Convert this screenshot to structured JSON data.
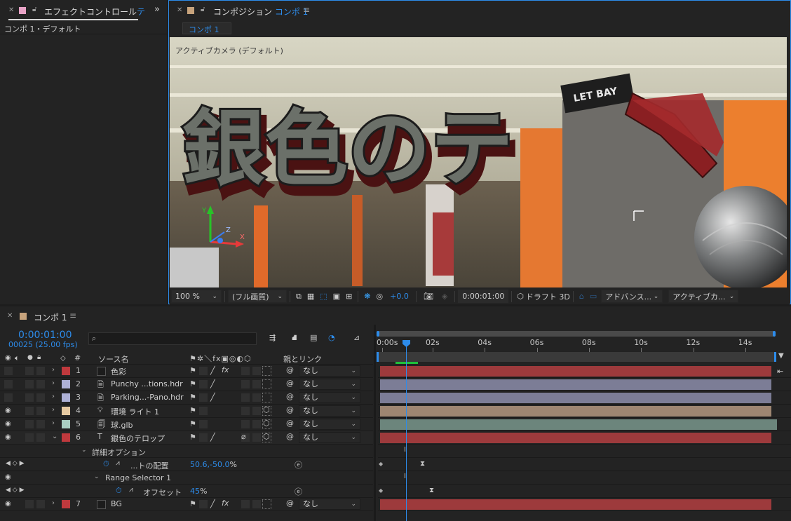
{
  "effect_panel": {
    "tab_title": "エフェクトコントロール",
    "tab_title_suffix": "テ",
    "subtitle": "コンポ 1・デフォルト"
  },
  "comp_panel": {
    "tab_prefix": "コンポジション",
    "tab_name": "コンポ 1",
    "subtab": "コンポ 1",
    "camera_label": "アクティブカメラ (デフォルト)",
    "overlay_text": "銀色のテ",
    "ground_text": "LET BAY",
    "zoom": "100 %",
    "resolution": "(フル画質)",
    "exposure": "+0.0",
    "timecode": "0:00:01:00",
    "renderer": "ドラフト 3D",
    "advanced": "アドバンス...",
    "view": "アクティブカ..."
  },
  "timeline": {
    "tab_name": "コンポ 1",
    "timecode": "0:00:01:00",
    "frame_info": "00025 (25.00 fps)",
    "search_placeholder": "",
    "col_hash": "#",
    "col_source": "ソース名",
    "col_parent": "親とリンク",
    "ruler": [
      "0:00s",
      "02s",
      "04s",
      "06s",
      "08s",
      "10s",
      "12s",
      "14s"
    ],
    "layers": [
      {
        "num": "1",
        "name": "色彩",
        "color": "#c0393d",
        "parent": "なし",
        "bar_color": "#9d3a3c"
      },
      {
        "num": "2",
        "name": "Punchy ...tions.hdr",
        "color": "#aeb1d6",
        "parent": "なし",
        "bar_color": "#7c7d96"
      },
      {
        "num": "3",
        "name": "Parking...-Pano.hdr",
        "color": "#aeb1d6",
        "parent": "なし",
        "bar_color": "#7c7d96"
      },
      {
        "num": "4",
        "name": "環境 ライト 1",
        "color": "#e6c9a1",
        "parent": "なし",
        "bar_color": "#9e8672"
      },
      {
        "num": "5",
        "name": "球.glb",
        "color": "#a9cfc2",
        "parent": "なし",
        "bar_color": "#6c857c"
      },
      {
        "num": "6",
        "name": "銀色のテロップ",
        "color": "#c0393d",
        "parent": "なし",
        "bar_color": "#9d3a3c"
      },
      {
        "num": "7",
        "name": "BG",
        "color": "#c0393d",
        "parent": "なし",
        "bar_color": "#9d3a3c"
      }
    ],
    "prop_advanced": "詳細オプション",
    "prop_position_name": "...トの配置",
    "prop_position_value": "50.6,-50.0",
    "prop_position_unit": "%",
    "prop_range": "Range Selector 1",
    "prop_offset_name": "オフセット",
    "prop_offset_value": "45",
    "prop_offset_unit": "%"
  },
  "colors": {
    "accent": "#2d8ceb",
    "red_label": "#c0393d"
  }
}
